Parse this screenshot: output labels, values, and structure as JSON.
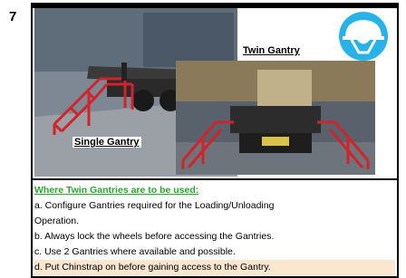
{
  "step": {
    "number": "7"
  },
  "captions": {
    "single": "Single Gantry",
    "twin": "Twin Gantry"
  },
  "icons": {
    "helmet": "chinstrap-helmet-icon",
    "helmet_color": "#28b2e8"
  },
  "instructions": {
    "heading": "Where Twin Gantries are to be used:",
    "heading_color": "#2ca52c",
    "lines": [
      "a. Configure Gantries required for the Loading/Unloading",
      "Operation.",
      "b. Always lock the wheels before accessing the Gantries.",
      "c.  Use 2 Gantries where available and possible.",
      "d. Put Chinstrap on before gaining access to the Gantry."
    ]
  }
}
